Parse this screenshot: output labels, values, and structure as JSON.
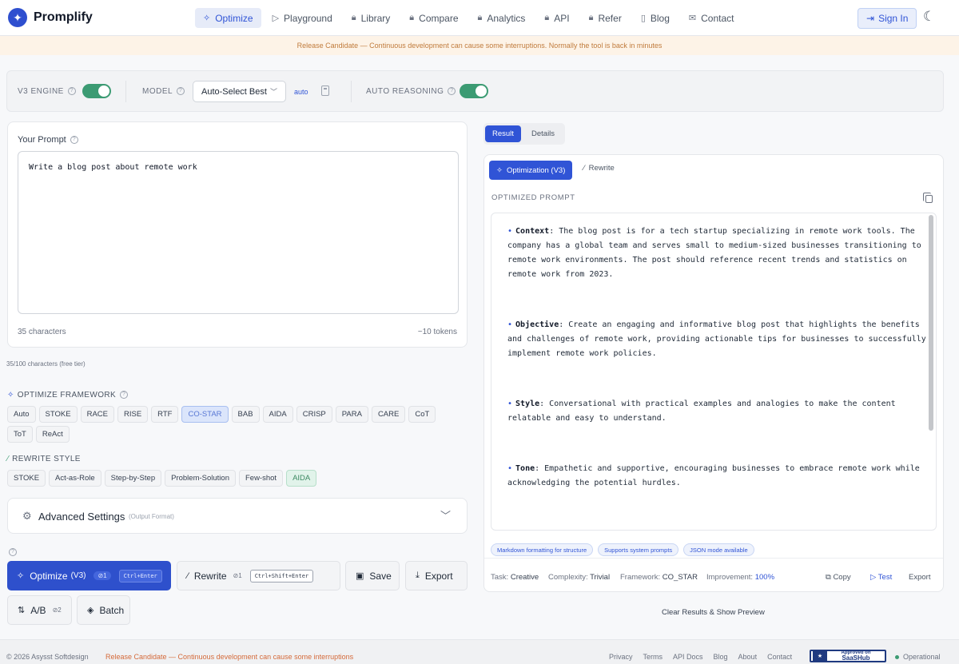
{
  "app": {
    "name": "Promplify"
  },
  "nav": {
    "items": [
      {
        "label": "Optimize",
        "icon": "sparkles-icon",
        "glyph": "✧"
      },
      {
        "label": "Playground",
        "icon": "play-icon",
        "glyph": "▷"
      },
      {
        "label": "Library",
        "icon": "lock-icon",
        "glyph": "🔒︎"
      },
      {
        "label": "Compare",
        "icon": "lock-icon",
        "glyph": "🔒︎"
      },
      {
        "label": "Analytics",
        "icon": "lock-icon",
        "glyph": "🔒︎"
      },
      {
        "label": "API",
        "icon": "lock-icon",
        "glyph": "🔒︎"
      },
      {
        "label": "Refer",
        "icon": "lock-icon",
        "glyph": "🔒︎"
      },
      {
        "label": "Blog",
        "icon": "book-icon",
        "glyph": "▯"
      },
      {
        "label": "Contact",
        "icon": "mail-icon",
        "glyph": "✉"
      }
    ],
    "sign_in": "Sign In"
  },
  "banner": {
    "text": "Release Candidate — Continuous development can cause some interruptions. Normally the tool is back in minutes"
  },
  "engine": {
    "v3_label": "V3 ENGINE",
    "v3_enabled": true,
    "model_label": "MODEL",
    "model_value": "Auto-Select Best",
    "auto_link": "auto",
    "auto_reasoning_label": "AUTO REASONING",
    "auto_reasoning_enabled": true
  },
  "prompt": {
    "label": "Your Prompt",
    "value": "Write a blog post about remote work",
    "char_count": "35 characters",
    "token_count": "~10 tokens",
    "free_tier": "35/100 characters (free tier)"
  },
  "frameworks": {
    "title": "OPTIMIZE FRAMEWORK",
    "items": [
      "Auto",
      "STOKE",
      "RACE",
      "RISE",
      "RTF",
      "CO-STAR",
      "BAB",
      "AIDA",
      "CRISP",
      "PARA",
      "CARE",
      "CoT",
      "ToT",
      "ReAct"
    ],
    "selected": "CO-STAR"
  },
  "rewrite_styles": {
    "title": "REWRITE STYLE",
    "items": [
      "STOKE",
      "Act-as-Role",
      "Step-by-Step",
      "Problem-Solution",
      "Few-shot",
      "AIDA"
    ],
    "selected": "AIDA"
  },
  "advanced": {
    "title": "Advanced Settings",
    "subtitle": "(Output Format)"
  },
  "actions": {
    "optimize": {
      "label": "Optimize",
      "version": "(V3)",
      "count": "1",
      "shortcut": "Ctrl+Enter"
    },
    "rewrite": {
      "label": "Rewrite",
      "count": "1",
      "shortcut": "Ctrl+Shift+Enter"
    },
    "save": "Save",
    "export": "Export",
    "ab": {
      "label": "A/B",
      "count": "2"
    },
    "batch": "Batch"
  },
  "result": {
    "tabs": [
      "Result",
      "Details"
    ],
    "optimization_button": "Optimization (V3)",
    "rewrite_button": "Rewrite",
    "optimized_label": "OPTIMIZED PROMPT",
    "sections": [
      {
        "key": "Context",
        "text": ": The blog post is for a tech startup specializing in remote work tools. The company has a global team and serves small to medium-sized businesses transitioning to remote work environments. The post should reference recent trends and statistics on remote work from 2023."
      },
      {
        "key": "Objective",
        "text": ": Create an engaging and informative blog post that highlights the benefits and challenges of remote work, providing actionable tips for businesses to successfully implement remote work policies."
      },
      {
        "key": "Style",
        "text": ": Conversational with practical examples and analogies to make the content relatable and easy to understand."
      },
      {
        "key": "Tone",
        "text": ": Empathetic and supportive, encouraging businesses to embrace remote work while acknowledging the potential hurdles."
      }
    ],
    "tags": [
      "Markdown formatting for structure",
      "Supports system prompts",
      "JSON mode available"
    ],
    "meta": {
      "task_label": "Task:",
      "task": "Creative",
      "complexity_label": "Complexity:",
      "complexity": "Trivial",
      "framework_label": "Framework:",
      "framework": "CO_STAR",
      "improvement_label": "Improvement:",
      "improvement": "100%"
    },
    "copy": "Copy",
    "test": "Test",
    "export": "Export",
    "clear": "Clear Results & Show Preview"
  },
  "footer": {
    "copyright": "© 2026 Asysst Softdesign",
    "rc_note": "Release Candidate — Continuous development can cause some interruptions",
    "links": [
      "Privacy",
      "Terms",
      "API Docs",
      "Blog",
      "About",
      "Contact"
    ],
    "badge_top": "Approved on",
    "badge_name": "SaaSHub",
    "status": "Operational"
  },
  "colors": {
    "accent": "#3054d6",
    "toggle_on": "#3c9b73",
    "banner_text": "#c07b3c"
  }
}
